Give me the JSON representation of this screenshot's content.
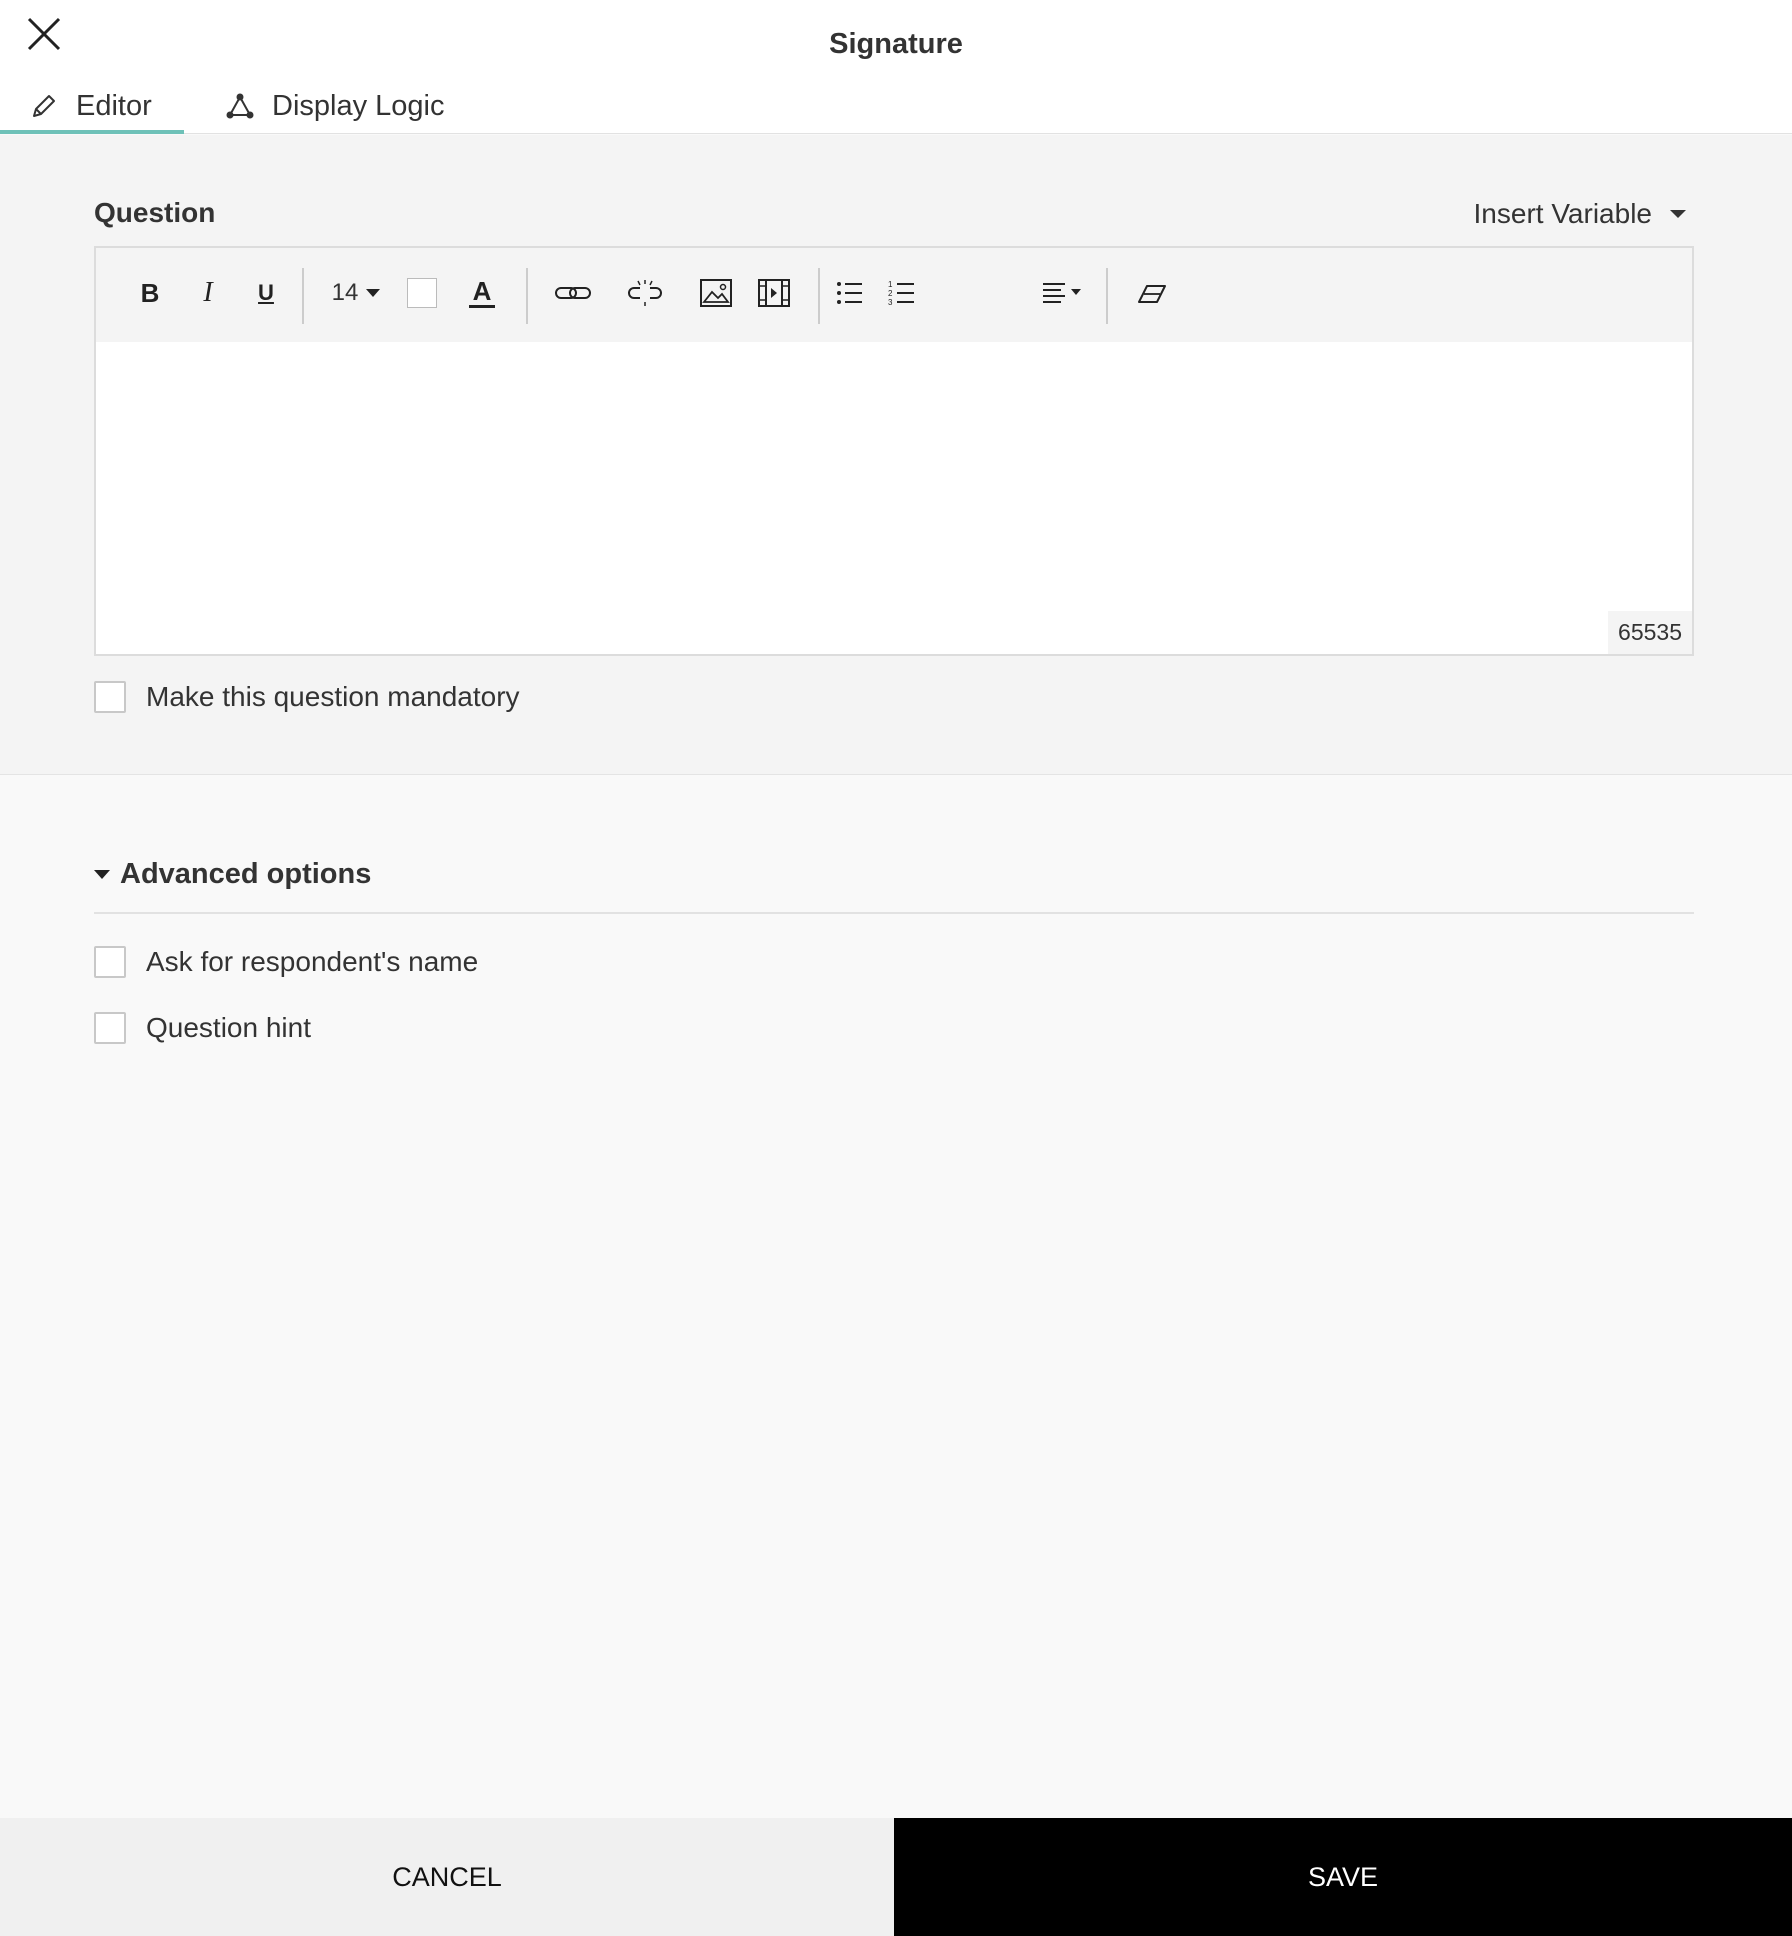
{
  "header": {
    "title": "Signature",
    "close_icon": "close-icon",
    "tabs": [
      {
        "label": "Editor",
        "icon": "pencil-icon",
        "active": true
      },
      {
        "label": "Display Logic",
        "icon": "logic-nodes-icon",
        "active": false
      }
    ]
  },
  "question": {
    "label": "Question",
    "insert_variable": "Insert Variable",
    "toolbar": {
      "bold": "B",
      "italic": "I",
      "underline": "U",
      "font_size": "14",
      "text_color_letter": "A"
    },
    "char_counter": "65535",
    "mandatory_label": "Make this question mandatory"
  },
  "advanced": {
    "title": "Advanced options",
    "options": [
      {
        "label": "Ask for respondent's name",
        "checked": false
      },
      {
        "label": "Question hint",
        "checked": false
      }
    ]
  },
  "footer": {
    "cancel_label": "CANCEL",
    "save_label": "SAVE"
  },
  "colors": {
    "accent": "#6ec1b8",
    "save_bg": "#000000",
    "cancel_bg": "#f0f0f0"
  }
}
